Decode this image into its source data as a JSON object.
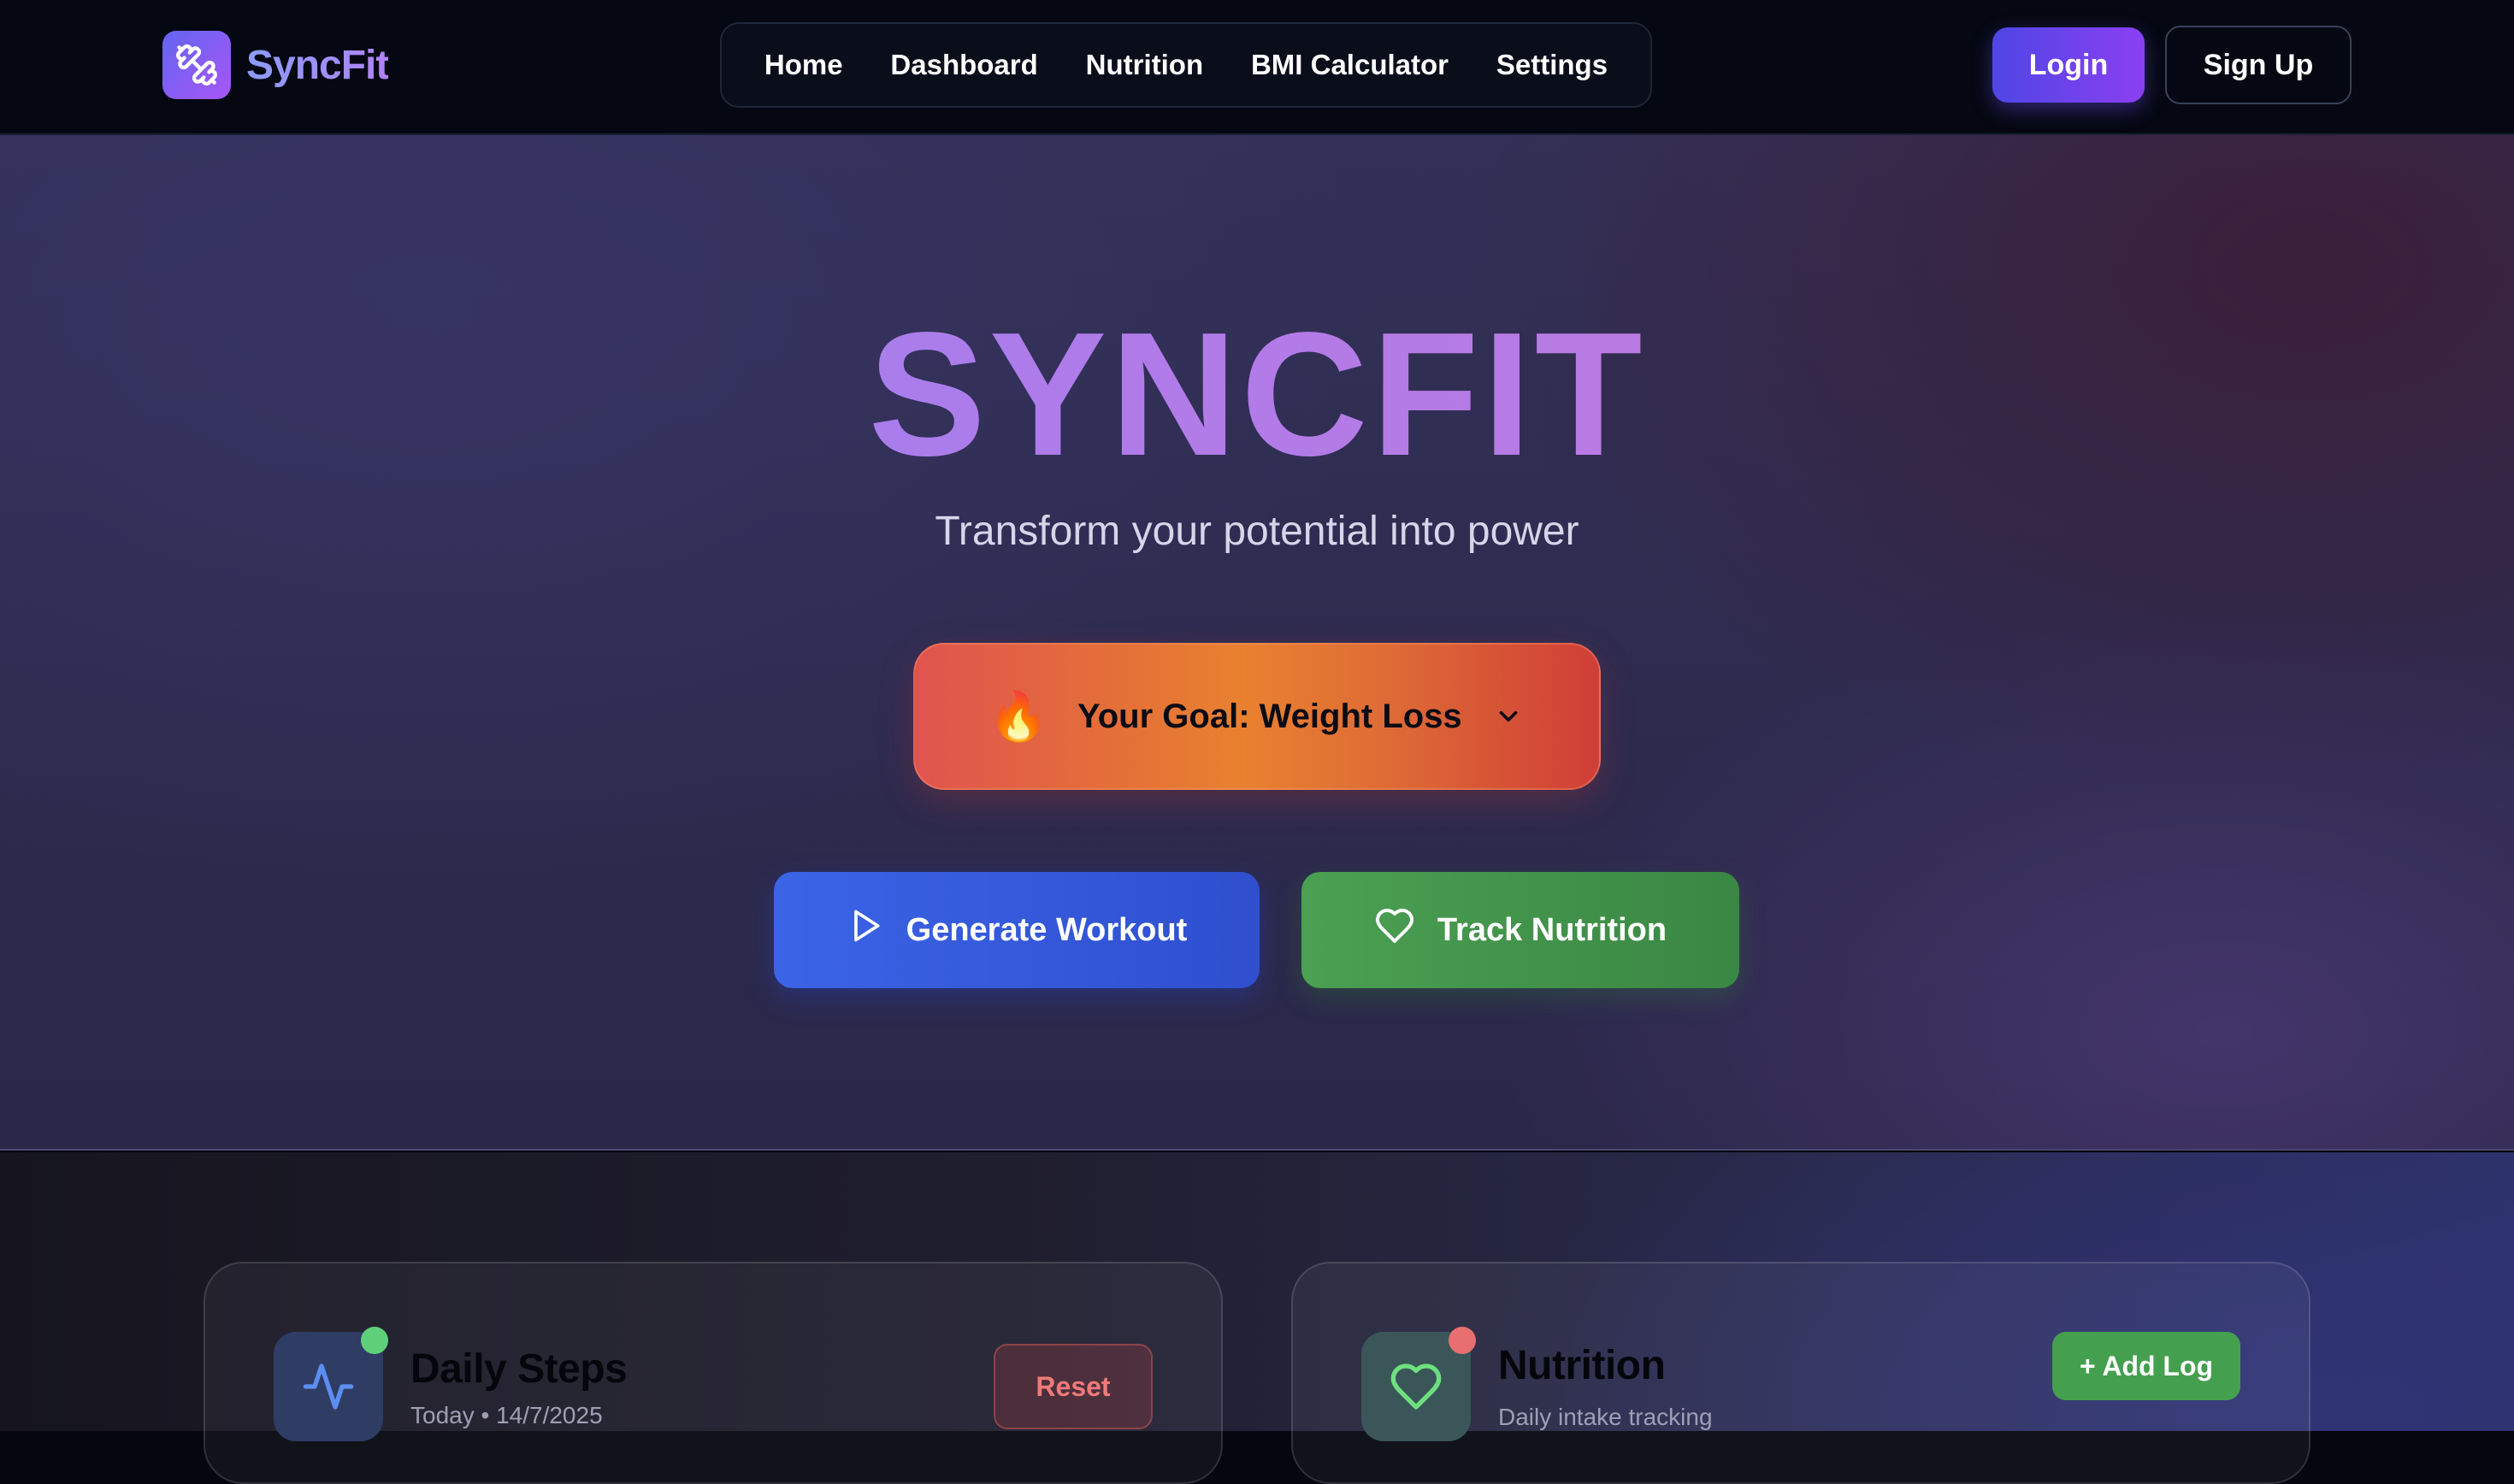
{
  "brand": {
    "name": "SyncFit",
    "logo_icon": "dumbbell-icon"
  },
  "nav": {
    "links": [
      "Home",
      "Dashboard",
      "Nutrition",
      "BMI Calculator",
      "Settings"
    ]
  },
  "auth": {
    "login_label": "Login",
    "signup_label": "Sign Up"
  },
  "hero": {
    "title": "SYNCFIT",
    "subtitle": "Transform your potential into power",
    "goal": {
      "emoji": "🔥",
      "label": "Your Goal: Weight Loss",
      "icon": "chevron-down-icon"
    },
    "primary_button": {
      "label": "Generate Workout",
      "icon": "play-icon"
    },
    "secondary_button": {
      "label": "Track Nutrition",
      "icon": "heart-icon"
    }
  },
  "cards": {
    "steps": {
      "title": "Daily Steps",
      "subtitle": "Today • 14/7/2025",
      "icon": "activity-icon",
      "action_label": "Reset",
      "status_color": "#5fd07a"
    },
    "nutrition": {
      "title": "Nutrition",
      "subtitle": "Daily intake tracking",
      "icon": "heart-icon",
      "action_label": "+ Add Log",
      "status_color": "#e86f6f"
    }
  },
  "colors": {
    "accent": "#6366f1",
    "workout_blue": "#3b64e6",
    "nutrition_green": "#4ba052",
    "goal_orange": "#e98130"
  }
}
